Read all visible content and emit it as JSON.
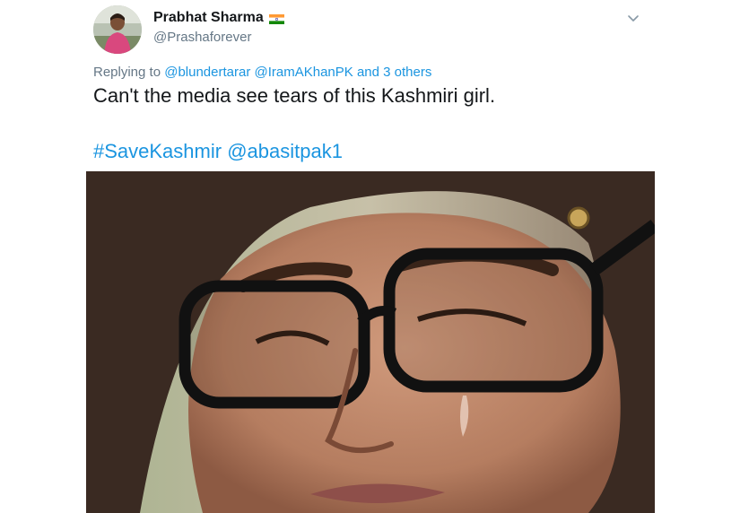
{
  "author": {
    "name": "Prabhat Sharma",
    "handle": "@Prashaforever",
    "flag_icon": "india-flag-icon"
  },
  "menu_icon": "chevron-down-icon",
  "reply": {
    "prefix": "Replying to",
    "mention_1": "@blundertarar",
    "mention_2": "@IramAKhanPK",
    "others": "and 3 others"
  },
  "tweet_text": "Can't the media see tears of this Kashmiri girl.",
  "hashtag": "#SaveKashmir",
  "mention": "@abasitpak1",
  "colors": {
    "link": "#1b95e0",
    "text": "#14171a",
    "secondary": "#657786"
  }
}
